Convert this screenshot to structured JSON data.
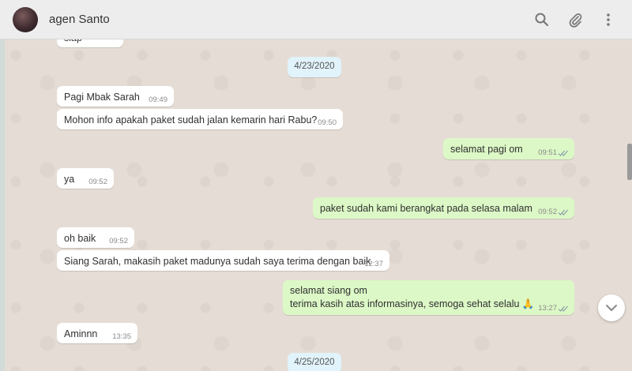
{
  "header": {
    "contact_name": "agen Santo",
    "icons": [
      "search-icon",
      "attach-icon",
      "menu-icon"
    ]
  },
  "messages": {
    "m0": {
      "text": "siap",
      "direction": "in"
    },
    "d1": {
      "date": "4/23/2020"
    },
    "m1": {
      "text": "Pagi Mbak Sarah",
      "time": "09:49",
      "direction": "in"
    },
    "m2": {
      "text": "Mohon info apakah paket sudah jalan kemarin hari Rabu?",
      "time": "09:50",
      "direction": "in"
    },
    "m3": {
      "text": "selamat pagi om",
      "time": "09:51",
      "direction": "out",
      "status": "read"
    },
    "m4": {
      "text": "ya",
      "time": "09:52",
      "direction": "in"
    },
    "m5": {
      "text": "paket sudah kami berangkat pada selasa malam",
      "time": "09:52",
      "direction": "out",
      "status": "read"
    },
    "m6": {
      "text": "oh baik",
      "time": "09:52",
      "direction": "in"
    },
    "m7": {
      "text": "Siang Sarah, makasih paket madunya sudah saya terima dengan baik",
      "time": "12:37",
      "direction": "in"
    },
    "m8": {
      "line1": "selamat siang om",
      "line2": "terima kasih atas informasinya, semoga sehat selalu 🙏",
      "time": "13:27",
      "direction": "out",
      "status": "read"
    },
    "m9": {
      "text": "Aminnn",
      "time": "13:35",
      "direction": "in"
    },
    "d2": {
      "date": "4/25/2020"
    }
  },
  "colors": {
    "header_bg": "#ededed",
    "chat_bg": "#e5ddd5",
    "incoming_bubble": "#ffffff",
    "outgoing_bubble": "#dcf8c6",
    "date_chip": "#e1f3fb"
  }
}
